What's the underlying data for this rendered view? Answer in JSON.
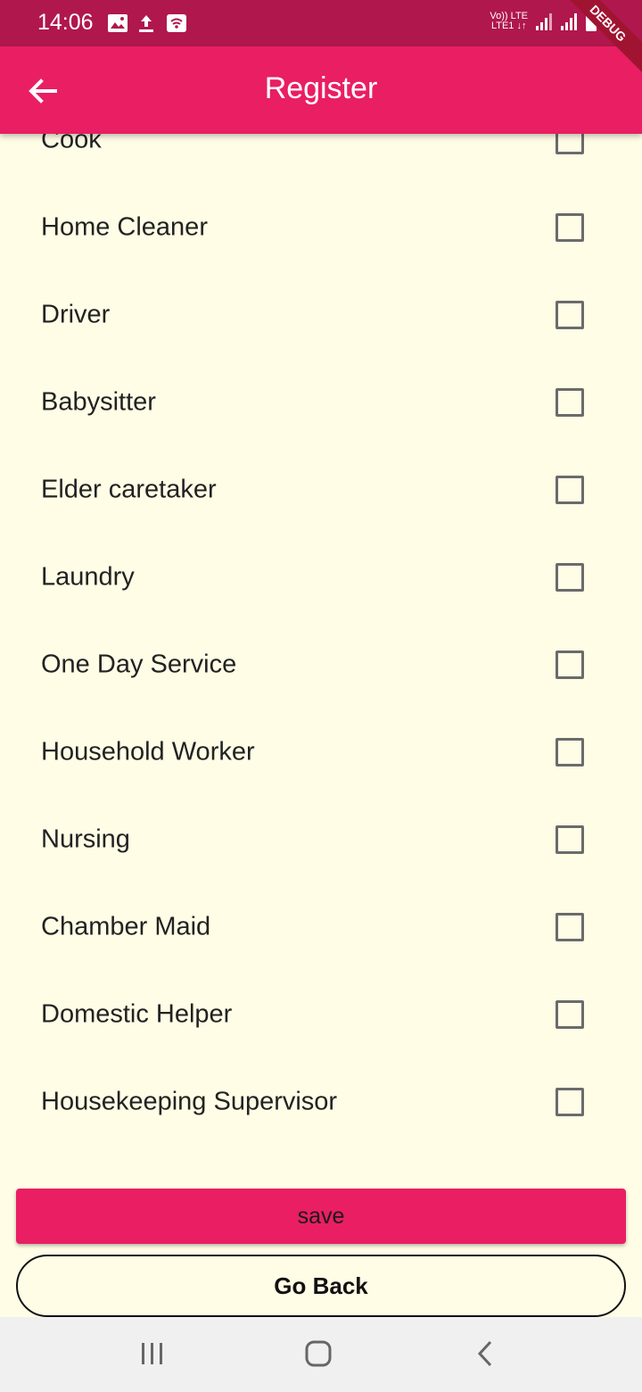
{
  "status_bar": {
    "time": "14:06",
    "icons": [
      "image-icon",
      "upload-icon",
      "wifi-calling-icon",
      "signal-icon",
      "battery-icon"
    ],
    "net_line1": "Vo)) LTE",
    "net_line2": "LTE1 ↓↑"
  },
  "debug_banner": "DEBUG",
  "app_bar": {
    "title": "Register",
    "color": "#E91E63"
  },
  "services": [
    {
      "label": "Cook",
      "checked": false
    },
    {
      "label": "Home Cleaner",
      "checked": false
    },
    {
      "label": "Driver",
      "checked": false
    },
    {
      "label": "Babysitter",
      "checked": false
    },
    {
      "label": "Elder caretaker",
      "checked": false
    },
    {
      "label": "Laundry",
      "checked": false
    },
    {
      "label": "One Day Service",
      "checked": false
    },
    {
      "label": "Household Worker",
      "checked": false
    },
    {
      "label": "Nursing",
      "checked": false
    },
    {
      "label": "Chamber Maid",
      "checked": false
    },
    {
      "label": "Domestic Helper",
      "checked": false
    },
    {
      "label": "Housekeeping Supervisor",
      "checked": false
    }
  ],
  "buttons": {
    "save": "save",
    "go_back": "Go Back"
  },
  "colors": {
    "status_bar": "#B0174D",
    "accent": "#E91E63",
    "background": "#FFFDE6"
  }
}
